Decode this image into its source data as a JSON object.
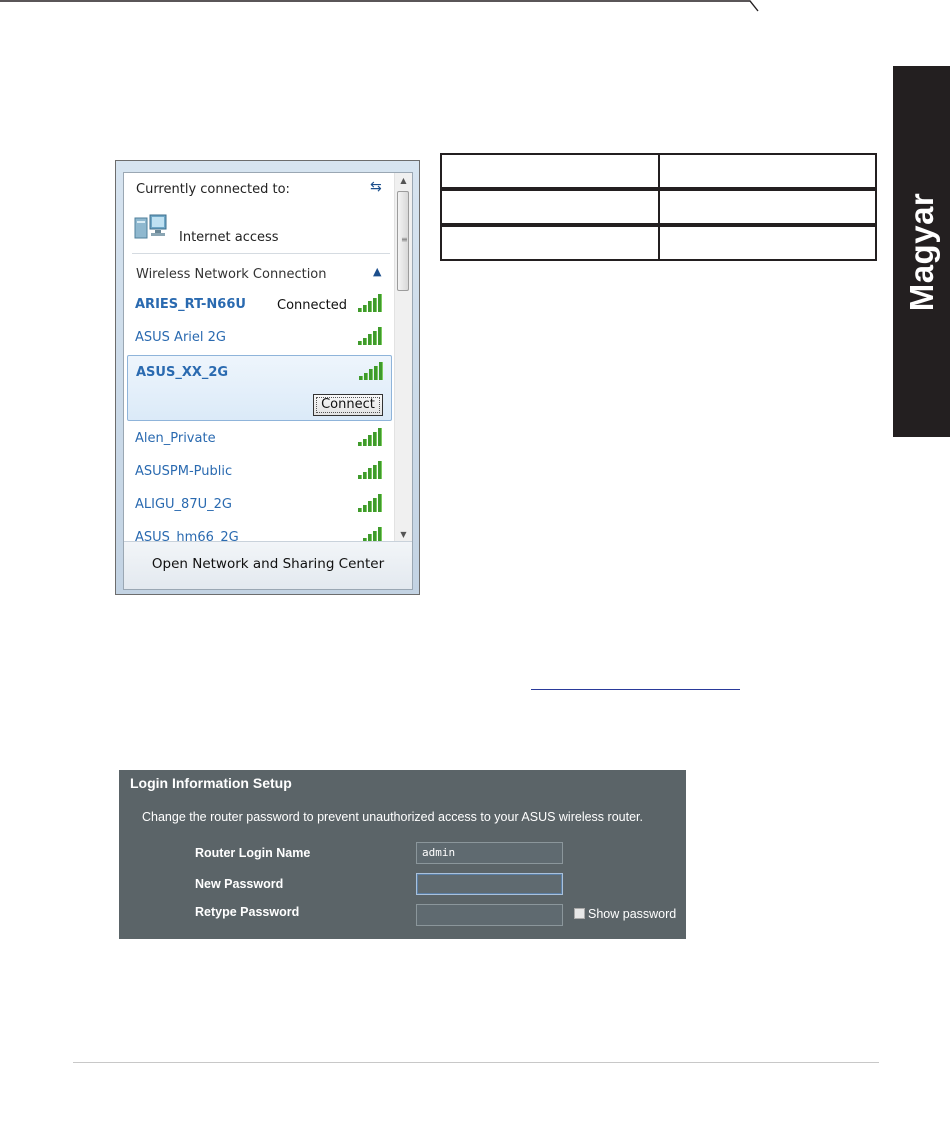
{
  "side_tab": {
    "label": "Magyar"
  },
  "network_popup": {
    "currently_connected_label": "Currently connected to:",
    "internet_access_label": "Internet access",
    "section_label": "Wireless Network Connection",
    "networks": [
      {
        "name": "ARIES_RT-N66U",
        "status": "Connected",
        "signal_bars": 5,
        "bold": true
      },
      {
        "name": "ASUS Ariel 2G",
        "status": "",
        "signal_bars": 5,
        "bold": false
      },
      {
        "name": "ASUS_XX_2G",
        "status": "",
        "signal_bars": 5,
        "bold": true,
        "selected": true
      },
      {
        "name": "Alen_Private",
        "status": "",
        "signal_bars": 5,
        "bold": false
      },
      {
        "name": "ASUSPM-Public",
        "status": "",
        "signal_bars": 5,
        "bold": false
      },
      {
        "name": "ALIGU_87U_2G",
        "status": "",
        "signal_bars": 5,
        "bold": false
      },
      {
        "name": "ASUS_hm66_2G",
        "status": "",
        "signal_bars": 5,
        "bold": false
      }
    ],
    "connect_button": "Connect",
    "footer_link": "Open Network and Sharing Center"
  },
  "login_setup": {
    "title": "Login Information Setup",
    "description": "Change the router password to prevent unauthorized access to your ASUS wireless router.",
    "router_login_name_label": "Router Login Name",
    "router_login_name_value": "admin",
    "new_password_label": "New Password",
    "retype_password_label": "Retype Password",
    "show_password_label": "Show password"
  },
  "colors": {
    "side_tab_bg": "#231f20",
    "network_link": "#2a6ab0",
    "signal_green": "#3f9a2c",
    "login_panel_bg": "#5b6468"
  }
}
